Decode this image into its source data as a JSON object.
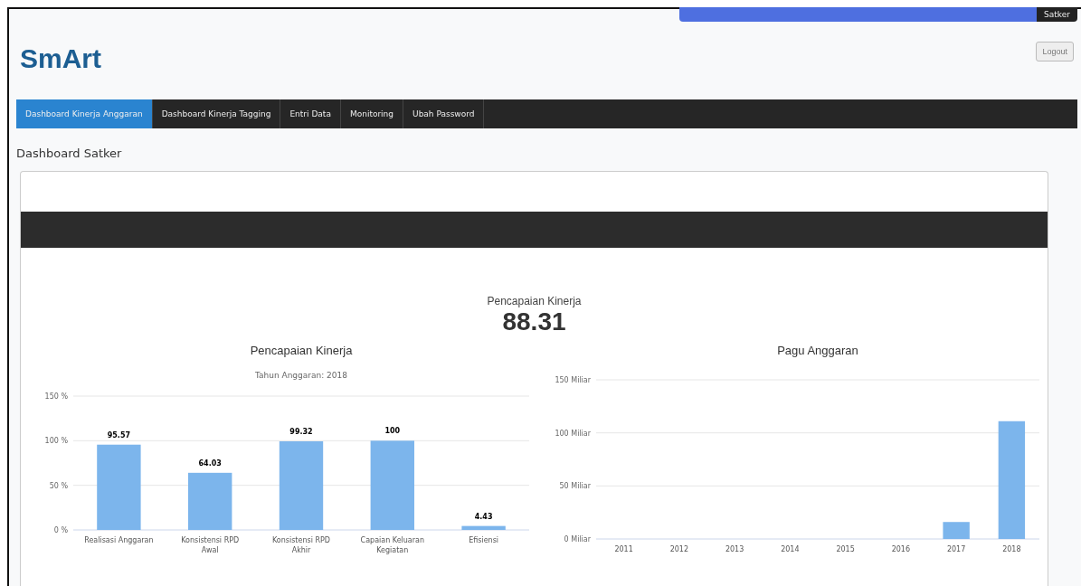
{
  "header": {
    "user_role": "Satker",
    "logo": "SmArt",
    "logout": "Logout"
  },
  "nav": [
    {
      "label": "Dashboard Kinerja Anggaran",
      "selected": true
    },
    {
      "label": "Dashboard Kinerja Tagging",
      "selected": false
    },
    {
      "label": "Entri Data",
      "selected": false
    },
    {
      "label": "Monitoring",
      "selected": false
    },
    {
      "label": "Ubah Password",
      "selected": false
    }
  ],
  "page_title": "Dashboard Satker",
  "summary": {
    "label": "Pencapaian Kinerja",
    "value": "88.31"
  },
  "charts": [
    {
      "chart_data": {
        "type": "bar",
        "title": "Pencapaian Kinerja",
        "subtitle": "Tahun Anggaran: 2018",
        "categories": [
          "Realisasi Anggaran",
          "Konsistensi RPD Awal",
          "Konsistensi RPD Akhir",
          "Capaian Keluaran Kegiatan",
          "Efisiensi"
        ],
        "series": [
          {
            "color": "#7cb5ec",
            "values": [
              95.57,
              64.03,
              99.32,
              100,
              4.43
            ]
          }
        ],
        "ylim": [
          0,
          150
        ],
        "yticks": [
          {
            "value": 0,
            "label": "0 %"
          },
          {
            "value": 50,
            "label": "50 %"
          },
          {
            "value": 100,
            "label": "100 %"
          },
          {
            "value": 150,
            "label": "150 %"
          }
        ],
        "data_labels": true,
        "value_labels": [
          "95.57",
          "64.03",
          "99.32",
          "100",
          "4.43"
        ]
      }
    },
    {
      "chart_data": {
        "type": "bar",
        "title": "Pagu Anggaran",
        "categories": [
          "2011",
          "2012",
          "2013",
          "2014",
          "2015",
          "2016",
          "2017",
          "2018"
        ],
        "series": [
          {
            "color": "#7cb5ec",
            "values": [
              0,
              0,
              0,
              0,
              0,
              0,
              16,
              111
            ]
          }
        ],
        "ylim": [
          0,
          150
        ],
        "yticks": [
          {
            "value": 0,
            "label": "0 Miliar"
          },
          {
            "value": 50,
            "label": "50 Miliar"
          },
          {
            "value": 100,
            "label": "100 Miliar"
          },
          {
            "value": 150,
            "label": "150 Miliar"
          }
        ]
      }
    }
  ]
}
